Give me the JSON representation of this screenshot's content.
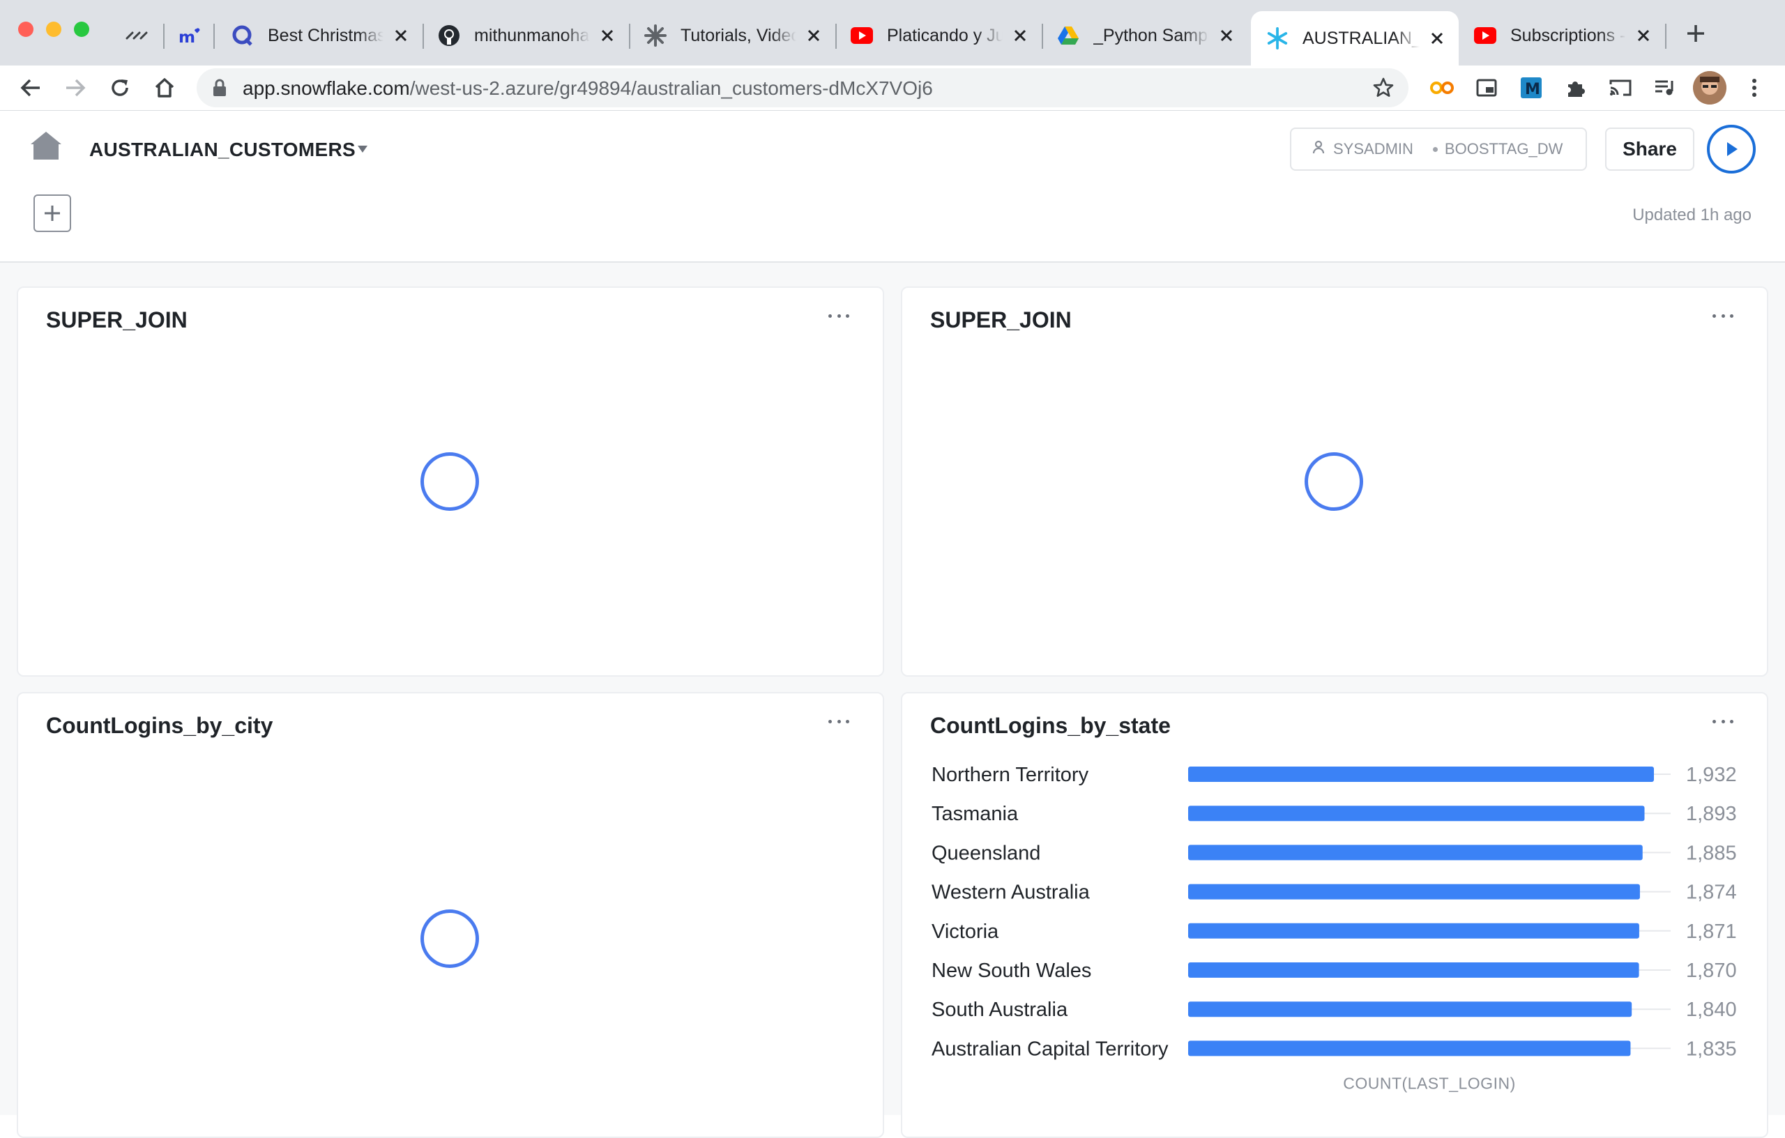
{
  "browser": {
    "tabs": [
      {
        "title": "",
        "icon": "dashes-icon"
      },
      {
        "title": "",
        "icon": "m-heart-icon"
      },
      {
        "title": "Best Christmas",
        "icon": "q-icon"
      },
      {
        "title": "mithunmanoha",
        "icon": "github-icon"
      },
      {
        "title": "Tutorials, Video",
        "icon": "snowflake-gear-icon"
      },
      {
        "title": "Platicando y Ju",
        "icon": "youtube-icon"
      },
      {
        "title": "_Python Sampl",
        "icon": "drive-icon"
      },
      {
        "title": "AUSTRALIAN_C",
        "icon": "snowflake-icon",
        "active": true
      },
      {
        "title": "Subscriptions -",
        "icon": "youtube-icon"
      }
    ],
    "new_tab": "+",
    "url_host": "app.snowflake.com",
    "url_path": "/west-us-2.azure/gr49894/australian_customers-dMcX7VOj6"
  },
  "header": {
    "title": "AUSTRALIAN_CUSTOMERS",
    "role": "SYSADMIN",
    "warehouse": "BOOSTTAG_DW",
    "share_label": "Share",
    "updated": "Updated 1h ago"
  },
  "tiles": [
    {
      "title": "SUPER_JOIN",
      "state": "loading"
    },
    {
      "title": "SUPER_JOIN",
      "state": "loading"
    },
    {
      "title": "CountLogins_by_city",
      "state": "loading"
    },
    {
      "title": "CountLogins_by_state",
      "state": "chart"
    }
  ],
  "colors": {
    "bar": "#3b82f6",
    "spinner": "#4a7bef",
    "run_button": "#1a6ed8"
  },
  "chart_data": {
    "type": "bar",
    "orientation": "horizontal",
    "title": "CountLogins_by_state",
    "categories": [
      "Northern Territory",
      "Tasmania",
      "Queensland",
      "Western Australia",
      "Victoria",
      "New South Wales",
      "South Australia",
      "Australian Capital Territory"
    ],
    "values": [
      1932,
      1893,
      1885,
      1874,
      1871,
      1870,
      1840,
      1835
    ],
    "value_labels": [
      "1,932",
      "1,893",
      "1,885",
      "1,874",
      "1,871",
      "1,870",
      "1,840",
      "1,835"
    ],
    "xlabel": "COUNT(LAST_LOGIN)",
    "ylabel": "",
    "xlim": [
      0,
      1932
    ]
  }
}
